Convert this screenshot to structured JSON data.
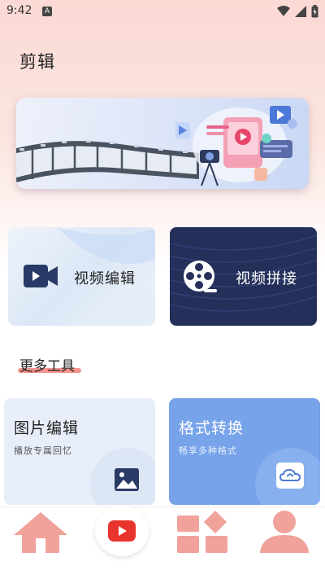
{
  "status": {
    "time": "9:42",
    "notif": "A"
  },
  "page_title": "剪辑",
  "cards": {
    "video_edit": "视频编辑",
    "video_join": "视频拼接"
  },
  "section_title": "更多工具",
  "tools": {
    "image": {
      "title": "图片编辑",
      "subtitle": "播放专属回忆"
    },
    "format": {
      "title": "格式转换",
      "subtitle": "畅享多种格式"
    }
  },
  "icons": {
    "status": [
      "wifi-icon",
      "signal-icon",
      "battery-icon"
    ],
    "nav": [
      "home-icon",
      "play-icon",
      "grid-icon",
      "profile-icon"
    ]
  },
  "colors": {
    "accent": "#f07a72",
    "nav_pink": "#f0a29b",
    "play_red": "#e8342c",
    "dark_card": "#24305a",
    "format_blue": "#76a3ea"
  }
}
